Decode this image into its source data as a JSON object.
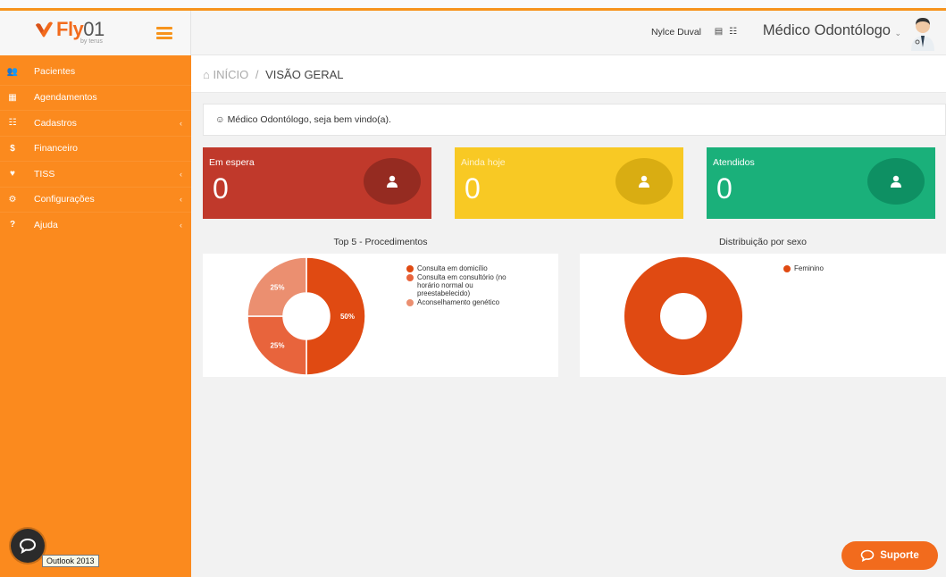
{
  "brand": {
    "name": "Fly",
    "name_suffix": "01",
    "subtitle": "by terus"
  },
  "sidebar": {
    "items": [
      {
        "icon": "users-icon",
        "glyph": "👥",
        "label": "Pacientes",
        "caret": ""
      },
      {
        "icon": "calendar-icon",
        "glyph": "▦",
        "label": "Agendamentos",
        "caret": ""
      },
      {
        "icon": "list-icon",
        "glyph": "☷",
        "label": "Cadastros",
        "caret": "‹"
      },
      {
        "icon": "dollar-icon",
        "glyph": "$",
        "label": "Financeiro",
        "caret": ""
      },
      {
        "icon": "heartbeat-icon",
        "glyph": "♥",
        "label": "TISS",
        "caret": "‹"
      },
      {
        "icon": "gear-icon",
        "glyph": "⚙",
        "label": "Configurações",
        "caret": "‹"
      },
      {
        "icon": "question-icon",
        "glyph": "?",
        "label": "Ajuda",
        "caret": "‹"
      }
    ]
  },
  "topbar": {
    "user_name": "Nylce Duval",
    "icons": "▤ ☷",
    "role": "Médico Odontólogo",
    "caret": "⌄"
  },
  "breadcrumb": {
    "home": "INÍCIO",
    "separator": "/",
    "current": "VISÃO GERAL"
  },
  "welcome": {
    "text": "☺ Médico Odontólogo, seja bem vindo(a)."
  },
  "cards": [
    {
      "title": "Em espera",
      "value": "0",
      "color": "#c0392b"
    },
    {
      "title": "Ainda hoje",
      "value": "0",
      "color": "#f8c924"
    },
    {
      "title": "Atendidos",
      "value": "0",
      "color": "#1ab07a"
    }
  ],
  "chart_data": [
    {
      "type": "pie",
      "title": "Top 5 - Procedimentos",
      "series": [
        {
          "name": "Consulta em domicílio",
          "value": 50,
          "label": "50%",
          "color": "#e04a12"
        },
        {
          "name": "Consulta em consultório (no horário normal ou preestabelecido)",
          "value": 25,
          "label": "25%",
          "color": "#e8643c"
        },
        {
          "name": "Aconselhamento genético",
          "value": 25,
          "label": "25%",
          "color": "#eb8f70"
        }
      ],
      "legend_position": "right"
    },
    {
      "type": "pie",
      "title": "Distribuição por sexo",
      "series": [
        {
          "name": "Feminino",
          "value": 100,
          "label": "",
          "color": "#e04a12"
        }
      ],
      "legend_position": "right"
    }
  ],
  "chat": {
    "tooltip": "Outlook 2013"
  },
  "support": {
    "label": "Suporte"
  },
  "colors": {
    "accent": "#f7941d",
    "sidebar": "#fb8a1e",
    "support": "#f26b1d"
  }
}
